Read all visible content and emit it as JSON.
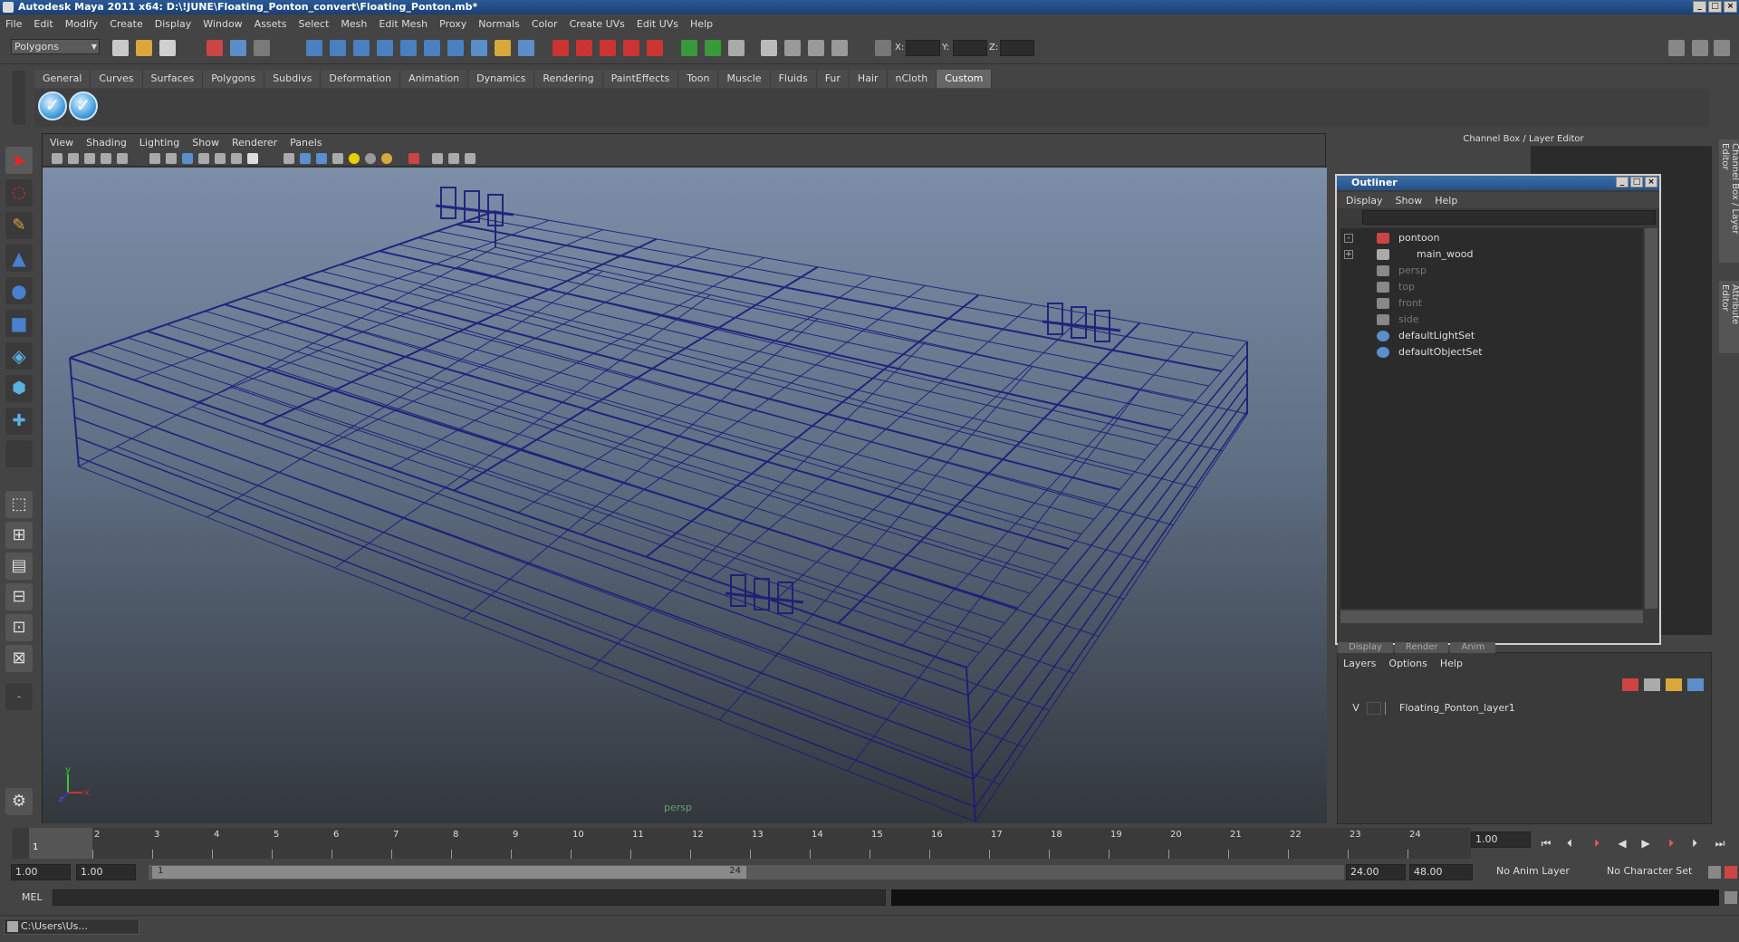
{
  "window": {
    "title": "Autodesk Maya 2011 x64: D:\\!JUNE\\Floating_Ponton_convert\\Floating_Ponton.mb*"
  },
  "menubar": [
    "File",
    "Edit",
    "Modify",
    "Create",
    "Display",
    "Window",
    "Assets",
    "Select",
    "Mesh",
    "Edit Mesh",
    "Proxy",
    "Normals",
    "Color",
    "Create UVs",
    "Edit UVs",
    "Help"
  ],
  "toolbar": {
    "mode": "Polygons",
    "x_label": "X:",
    "y_label": "Y:",
    "z_label": "Z:"
  },
  "shelf_tabs": [
    "General",
    "Curves",
    "Surfaces",
    "Polygons",
    "Subdivs",
    "Deformation",
    "Animation",
    "Dynamics",
    "Rendering",
    "PaintEffects",
    "Toon",
    "Muscle",
    "Fluids",
    "Fur",
    "Hair",
    "nCloth",
    "Custom"
  ],
  "shelf_active": "Custom",
  "viewport": {
    "menu": [
      "View",
      "Shading",
      "Lighting",
      "Show",
      "Renderer",
      "Panels"
    ],
    "camera": "persp",
    "axis_y": "y",
    "axis_x": "x",
    "axis_z": "z",
    "wire_color": "#1a1a7a"
  },
  "channel_box": {
    "title": "Channel Box / Layer Editor",
    "side_tab1": "Channel Box / Layer Editor",
    "side_tab2": "Attribute Editor"
  },
  "outliner": {
    "title": "Outliner",
    "menu": [
      "Display",
      "Show",
      "Help"
    ],
    "items": [
      {
        "label": "pontoon",
        "dim": false
      },
      {
        "label": "main_wood",
        "dim": false
      },
      {
        "label": "persp",
        "dim": true
      },
      {
        "label": "top",
        "dim": true
      },
      {
        "label": "front",
        "dim": true
      },
      {
        "label": "side",
        "dim": true
      },
      {
        "label": "defaultLightSet",
        "dim": false
      },
      {
        "label": "defaultObjectSet",
        "dim": false
      }
    ]
  },
  "layers": {
    "tabs": [
      "Display",
      "Render",
      "Anim"
    ],
    "menu": [
      "Layers",
      "Options",
      "Help"
    ],
    "row": {
      "visible": "V",
      "name": "Floating_Ponton_layer1"
    }
  },
  "timeline": {
    "ticks": [
      "1",
      "2",
      "3",
      "4",
      "5",
      "6",
      "7",
      "8",
      "9",
      "10",
      "11",
      "12",
      "13",
      "14",
      "15",
      "16",
      "17",
      "18",
      "19",
      "20",
      "21",
      "22",
      "23",
      "24"
    ],
    "current": "1",
    "current_time": "1.00"
  },
  "range": {
    "start": "1.00",
    "playback_start": "1.00",
    "slider_start": "1",
    "slider_end": "24",
    "playback_end": "24.00",
    "end": "48.00",
    "anim_layer": "No Anim Layer",
    "char_set": "No Character Set"
  },
  "mel": {
    "label": "MEL"
  },
  "taskbar": {
    "label": "C:\\Users\\Us..."
  }
}
